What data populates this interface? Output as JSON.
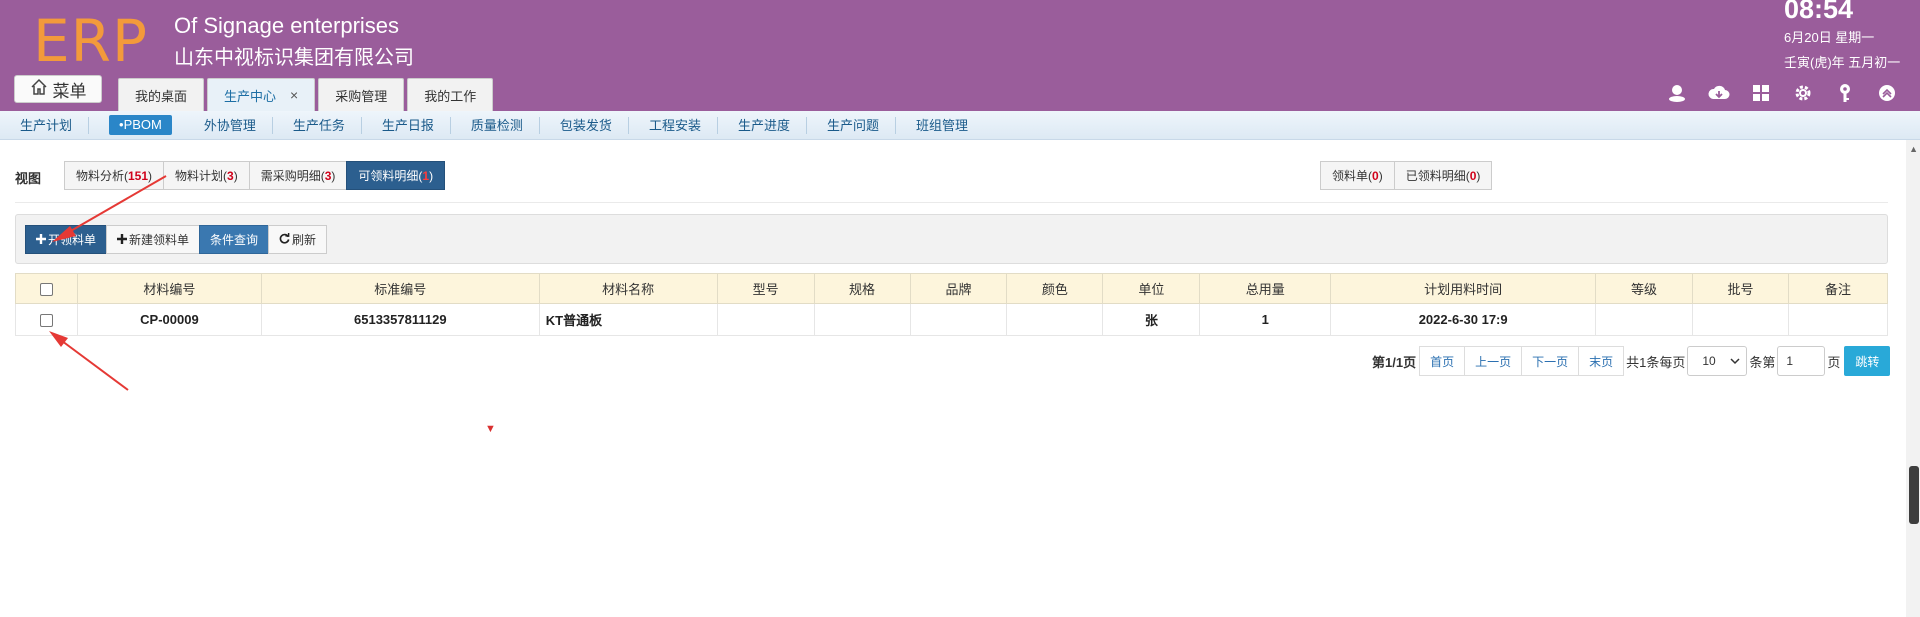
{
  "header": {
    "logo": "ERP",
    "company_en": "Of Signage enterprises",
    "company_cn": "山东中视标识集团有限公司",
    "time": "08:54",
    "date": "6月20日 星期一",
    "lunar": "壬寅(虎)年 五月初一"
  },
  "menu_label": "菜单",
  "tabs": [
    {
      "label": "我的桌面"
    },
    {
      "label": "生产中心",
      "close": "×"
    },
    {
      "label": "采购管理"
    },
    {
      "label": "我的工作"
    }
  ],
  "header_icons": [
    "user-icon",
    "cloud-download-icon",
    "apps-icon",
    "gear-icon",
    "key-icon",
    "collapse-up-icon"
  ],
  "subnav": [
    "生产计划",
    "•PBOM",
    "外协管理",
    "生产任务",
    "生产日报",
    "质量检测",
    "包装发货",
    "工程安装",
    "生产进度",
    "生产问题",
    "班组管理"
  ],
  "view": {
    "label": "视图",
    "buttons": [
      {
        "text": "物料分析(",
        "count": "151",
        "suffix": ")"
      },
      {
        "text": "物料计划(",
        "count": "3",
        "suffix": ")"
      },
      {
        "text": "需采购明细(",
        "count": "3",
        "suffix": ")"
      },
      {
        "text": "可领料明细(",
        "count": "1",
        "suffix": ")"
      }
    ],
    "right_buttons": [
      {
        "text": "领料单(",
        "count": "0",
        "suffix": ")"
      },
      {
        "text": "已领料明细(",
        "count": "0",
        "suffix": ")"
      }
    ]
  },
  "toolbar": {
    "open_requisition": "开领料单",
    "new_requisition": "新建领料单",
    "query": "条件查询",
    "refresh": "刷新"
  },
  "table": {
    "headers": [
      "材料编号",
      "标准编号",
      "材料名称",
      "型号",
      "规格",
      "品牌",
      "颜色",
      "单位",
      "总用量",
      "计划用料时间",
      "等级",
      "批号",
      "备注"
    ],
    "rows": [
      [
        "CP-00009",
        "6513357811129",
        "KT普通板",
        "",
        "",
        "",
        "",
        "张",
        "1",
        "2022-6-30 17:9",
        "",
        "",
        ""
      ]
    ]
  },
  "pager": {
    "page_info": "第1/1页",
    "first": "首页",
    "prev": "上一页",
    "next": "下一页",
    "last": "末页",
    "total": "共1条每页",
    "per_page": "10",
    "goto_prefix": "条第",
    "page_input": "1",
    "goto_suffix": "页",
    "jump": "跳转"
  },
  "marker": "▼",
  "colors": {
    "header_bg": "#9a5d9b",
    "logo": "#f39a3b",
    "primary": "#2c5f8f",
    "count_red": "#d0021b",
    "jump_btn": "#29a9d8",
    "arrow_red": "#e53935"
  }
}
